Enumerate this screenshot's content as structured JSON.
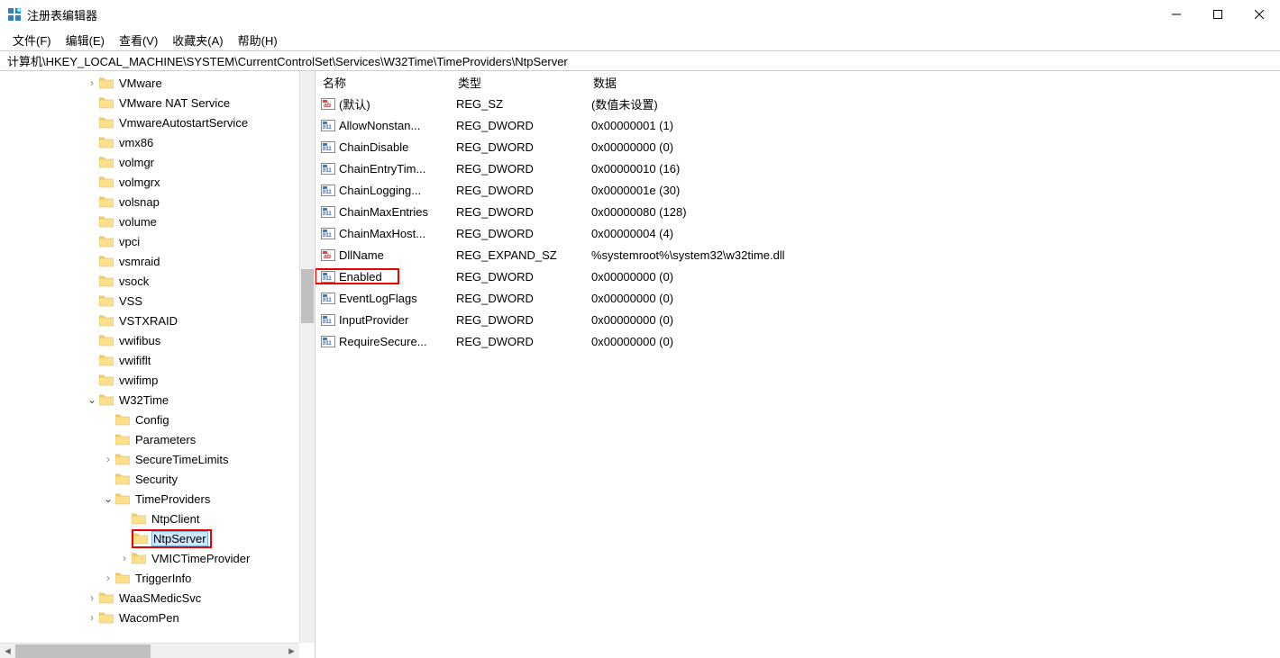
{
  "title": "注册表编辑器",
  "menu": {
    "file": "文件(F)",
    "edit": "编辑(E)",
    "view": "查看(V)",
    "fav": "收藏夹(A)",
    "help": "帮助(H)"
  },
  "address": "计算机\\HKEY_LOCAL_MACHINE\\SYSTEM\\CurrentControlSet\\Services\\W32Time\\TimeProviders\\NtpServer",
  "tree": [
    {
      "d": 5,
      "ch": ">",
      "label": "VMware"
    },
    {
      "d": 5,
      "ch": "",
      "label": "VMware NAT Service"
    },
    {
      "d": 5,
      "ch": "",
      "label": "VmwareAutostartService"
    },
    {
      "d": 5,
      "ch": "",
      "label": "vmx86"
    },
    {
      "d": 5,
      "ch": "",
      "label": "volmgr"
    },
    {
      "d": 5,
      "ch": "",
      "label": "volmgrx"
    },
    {
      "d": 5,
      "ch": "",
      "label": "volsnap"
    },
    {
      "d": 5,
      "ch": "",
      "label": "volume"
    },
    {
      "d": 5,
      "ch": "",
      "label": "vpci"
    },
    {
      "d": 5,
      "ch": "",
      "label": "vsmraid"
    },
    {
      "d": 5,
      "ch": "",
      "label": "vsock"
    },
    {
      "d": 5,
      "ch": "",
      "label": "VSS"
    },
    {
      "d": 5,
      "ch": "",
      "label": "VSTXRAID"
    },
    {
      "d": 5,
      "ch": "",
      "label": "vwifibus"
    },
    {
      "d": 5,
      "ch": "",
      "label": "vwififlt"
    },
    {
      "d": 5,
      "ch": "",
      "label": "vwifimp"
    },
    {
      "d": 5,
      "ch": "v",
      "label": "W32Time"
    },
    {
      "d": 6,
      "ch": "",
      "label": "Config"
    },
    {
      "d": 6,
      "ch": "",
      "label": "Parameters"
    },
    {
      "d": 6,
      "ch": ">",
      "label": "SecureTimeLimits"
    },
    {
      "d": 6,
      "ch": "",
      "label": "Security"
    },
    {
      "d": 6,
      "ch": "v",
      "label": "TimeProviders"
    },
    {
      "d": 7,
      "ch": "",
      "label": "NtpClient"
    },
    {
      "d": 7,
      "ch": "",
      "label": "NtpServer",
      "selected": true,
      "boxed": true
    },
    {
      "d": 7,
      "ch": ">",
      "label": "VMICTimeProvider"
    },
    {
      "d": 6,
      "ch": ">",
      "label": "TriggerInfo"
    },
    {
      "d": 5,
      "ch": ">",
      "label": "WaaSMedicSvc"
    },
    {
      "d": 5,
      "ch": ">",
      "label": "WacomPen"
    }
  ],
  "columns": {
    "name": "名称",
    "type": "类型",
    "data": "数据"
  },
  "values": [
    {
      "icon": "str",
      "name": "(默认)",
      "type": "REG_SZ",
      "data": "(数值未设置)"
    },
    {
      "icon": "num",
      "name": "AllowNonstan...",
      "type": "REG_DWORD",
      "data": "0x00000001 (1)"
    },
    {
      "icon": "num",
      "name": "ChainDisable",
      "type": "REG_DWORD",
      "data": "0x00000000 (0)"
    },
    {
      "icon": "num",
      "name": "ChainEntryTim...",
      "type": "REG_DWORD",
      "data": "0x00000010 (16)"
    },
    {
      "icon": "num",
      "name": "ChainLogging...",
      "type": "REG_DWORD",
      "data": "0x0000001e (30)"
    },
    {
      "icon": "num",
      "name": "ChainMaxEntries",
      "type": "REG_DWORD",
      "data": "0x00000080 (128)"
    },
    {
      "icon": "num",
      "name": "ChainMaxHost...",
      "type": "REG_DWORD",
      "data": "0x00000004 (4)"
    },
    {
      "icon": "str",
      "name": "DllName",
      "type": "REG_EXPAND_SZ",
      "data": "%systemroot%\\system32\\w32time.dll"
    },
    {
      "icon": "num",
      "name": "Enabled",
      "type": "REG_DWORD",
      "data": "0x00000000 (0)",
      "hl": true
    },
    {
      "icon": "num",
      "name": "EventLogFlags",
      "type": "REG_DWORD",
      "data": "0x00000000 (0)"
    },
    {
      "icon": "num",
      "name": "InputProvider",
      "type": "REG_DWORD",
      "data": "0x00000000 (0)"
    },
    {
      "icon": "num",
      "name": "RequireSecure...",
      "type": "REG_DWORD",
      "data": "0x00000000 (0)"
    }
  ]
}
